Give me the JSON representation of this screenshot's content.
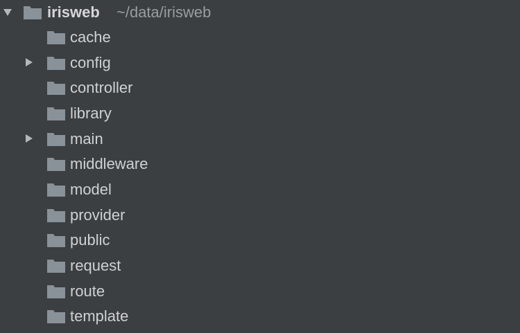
{
  "root": {
    "name": "irisweb",
    "path": "~/data/irisweb",
    "expanded": true,
    "icon": "folder-icon"
  },
  "children": [
    {
      "label": "cache",
      "expandable": false
    },
    {
      "label": "config",
      "expandable": true
    },
    {
      "label": "controller",
      "expandable": false
    },
    {
      "label": "library",
      "expandable": false
    },
    {
      "label": "main",
      "expandable": true
    },
    {
      "label": "middleware",
      "expandable": false
    },
    {
      "label": "model",
      "expandable": false
    },
    {
      "label": "provider",
      "expandable": false
    },
    {
      "label": "public",
      "expandable": false
    },
    {
      "label": "request",
      "expandable": false
    },
    {
      "label": "route",
      "expandable": false
    },
    {
      "label": "template",
      "expandable": false
    }
  ],
  "colors": {
    "background": "#3c3f41",
    "folder": "#8a9299",
    "text": "#cfd2d4",
    "path_text": "#9a9da0",
    "arrow": "#b5b8bb"
  }
}
